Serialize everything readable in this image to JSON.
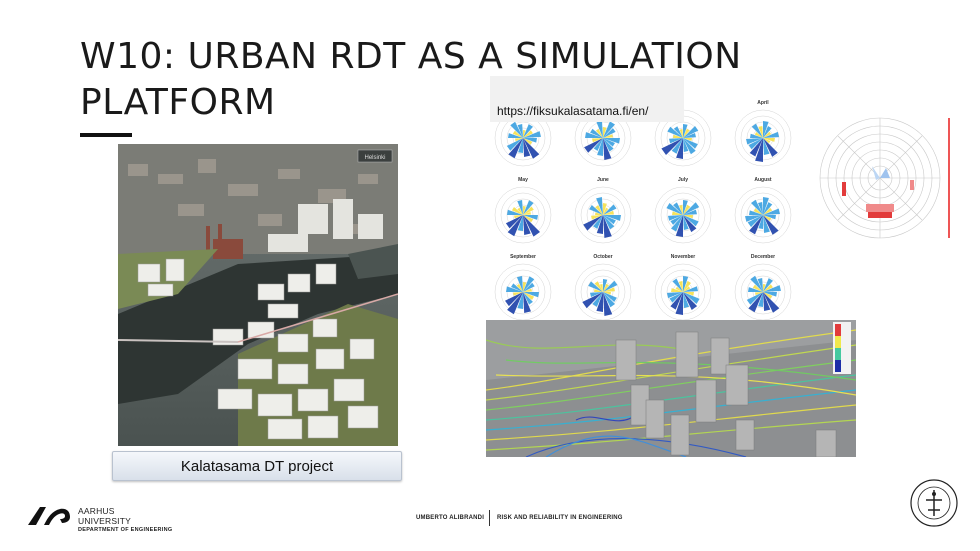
{
  "slide": {
    "title": "W10: URBAN RDT AS A SIMULATION PLATFORM",
    "caption": "Kalatasama DT project",
    "url": "https://fiksukalasatama.fi/en/",
    "city_label": "Helsinki",
    "months": [
      "",
      "",
      "",
      "April",
      "May",
      "June",
      "July",
      "August",
      "September",
      "October",
      "November",
      "December"
    ]
  },
  "footer": {
    "university_line1": "AARHUS",
    "university_line2": "UNIVERSITY",
    "department": "DEPARTMENT OF ENGINEERING",
    "author": "UMBERTO ALIBRANDI",
    "course": "RISK AND RELIABILITY IN ENGINEERING"
  },
  "colors": {
    "title": "#1a1a1a",
    "accent_bar": "#111111",
    "rose_high": "#f5e04a",
    "rose_mid": "#3aa0e0",
    "rose_low": "#1b3fa8"
  },
  "icons": [
    "aarhus-university-logo",
    "university-seal"
  ]
}
